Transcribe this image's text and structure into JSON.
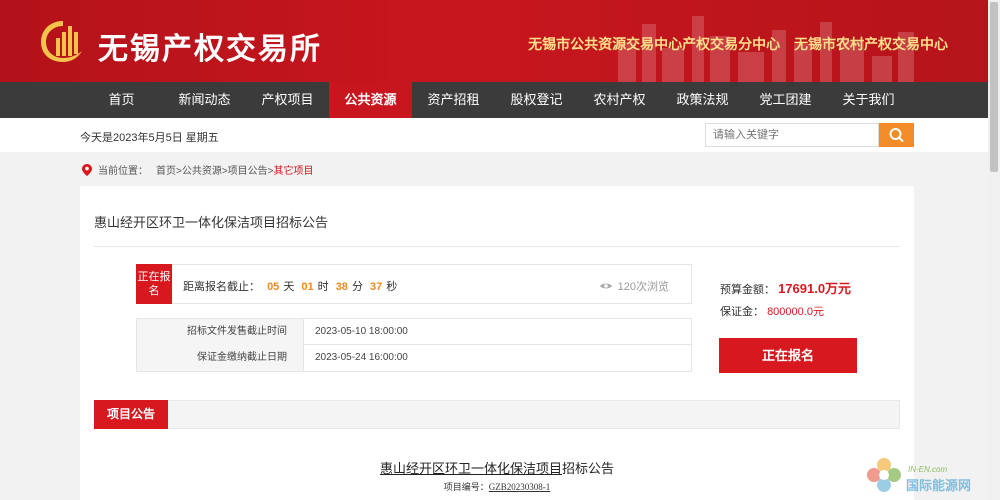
{
  "header": {
    "site_name": "无锡产权交易所",
    "sub_left": "无锡市公共资源交易中心产权交易分中心",
    "sub_right": "无锡市农村产权交易中心"
  },
  "nav": {
    "items": [
      "首页",
      "新闻动态",
      "产权项目",
      "公共资源",
      "资产招租",
      "股权登记",
      "农村产权",
      "政策法规",
      "党工团建",
      "关于我们"
    ],
    "active_index": 3
  },
  "topbar": {
    "date": "今天是2023年5月5日 星期五",
    "search_placeholder": "请输入关键字"
  },
  "breadcrumb": {
    "prefix": "当前位置：",
    "path": "首页>公共资源>项目公告>",
    "current": "其它项目"
  },
  "project": {
    "title": "惠山经开区环卫一体化保洁项目招标公告",
    "status_badge": "正在报名",
    "countdown_label": "距离报名截止：",
    "days": "05",
    "days_unit": "天",
    "hours": "01",
    "hours_unit": "时",
    "minutes": "38",
    "minutes_unit": "分",
    "seconds": "37",
    "seconds_unit": "秒",
    "views": "120次浏览",
    "dates": [
      {
        "label": "招标文件发售截止时间",
        "value": "2023-05-10 18:00:00"
      },
      {
        "label": "保证金缴纳截止日期",
        "value": "2023-05-24 16:00:00"
      }
    ],
    "budget_label": "预算金额：",
    "budget_value": "17691.0万元",
    "deposit_label": "保证金：",
    "deposit_value": "800000.0元",
    "signup_button": "正在报名"
  },
  "tabs": {
    "announcement": "项目公告"
  },
  "document": {
    "title_underlined": "惠山经开区环卫一体化保洁项目",
    "title_rest": "招标公告",
    "number_label": "项目编号：",
    "number_value": "GZB20230308-1"
  },
  "watermark": {
    "line1": "IN-EN.com",
    "line2": "国际能源网"
  },
  "colors": {
    "brand_red": "#c8161e",
    "nav_dark": "#3b3b3b",
    "accent_orange": "#f28c28",
    "countdown_orange": "#f08a1c"
  }
}
